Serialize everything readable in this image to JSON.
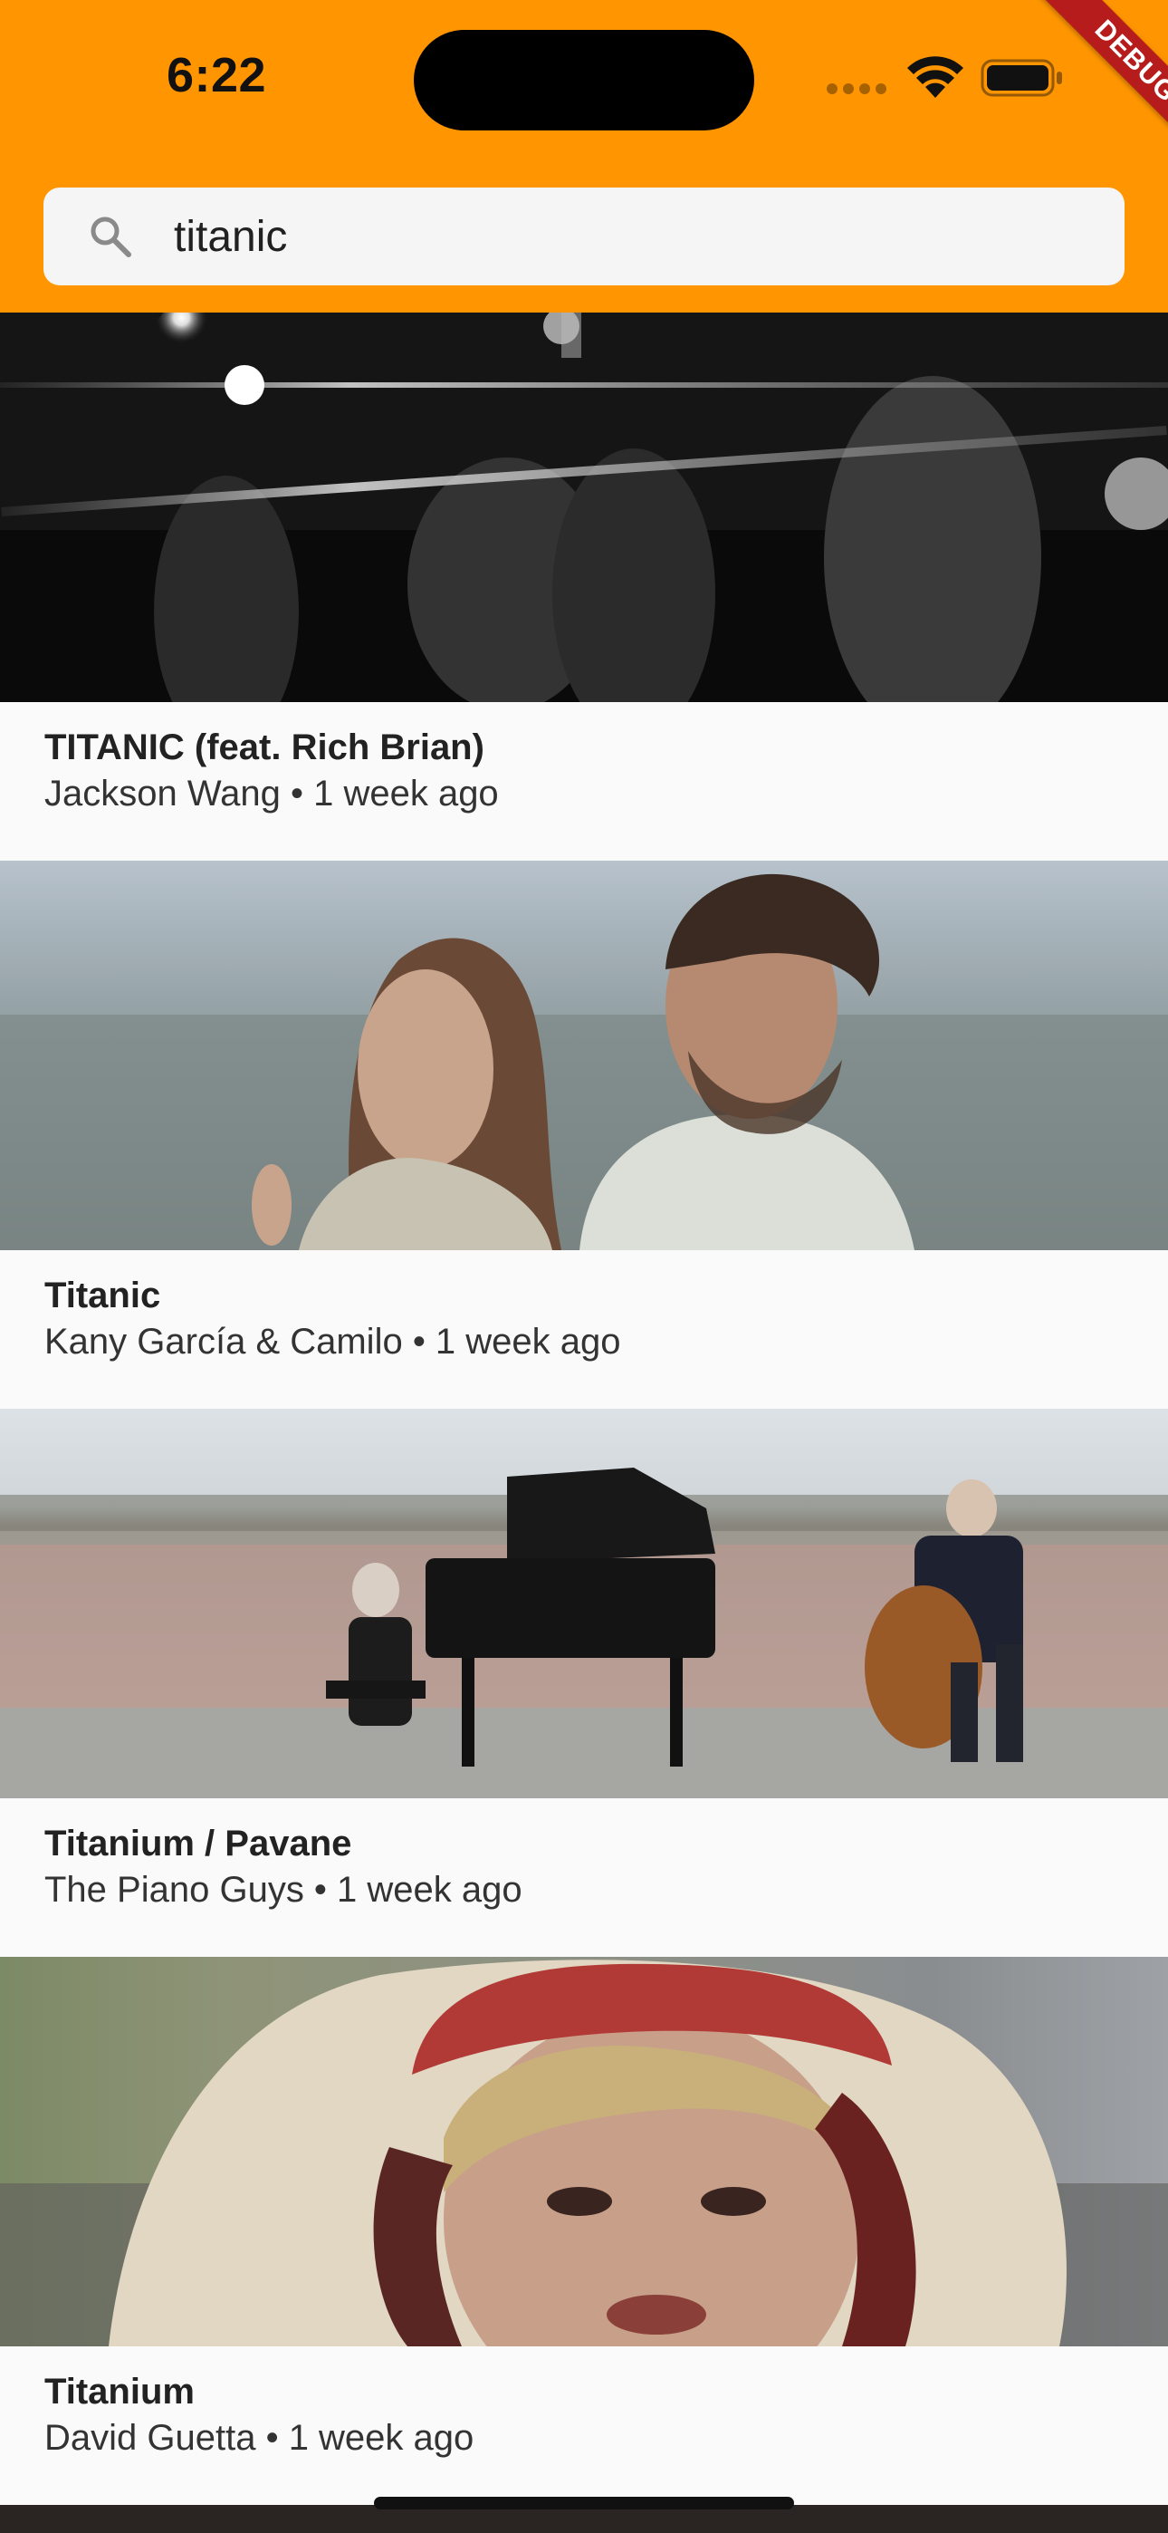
{
  "status_bar": {
    "time": "6:22"
  },
  "debug_banner": "DEBUG",
  "search": {
    "value": "titanic",
    "icon": "search-icon"
  },
  "colors": {
    "app_bar": "#ff9500",
    "search_field": "#f5f5f5",
    "background": "#fafafa",
    "debug_banner": "#b71c1c"
  },
  "videos": [
    {
      "title": "TITANIC (feat. Rich Brian)",
      "channel": "Jackson Wang",
      "age": "1 week ago",
      "meta": "Jackson Wang • 1 week ago"
    },
    {
      "title": "Titanic",
      "channel": "Kany García & Camilo",
      "age": "1 week ago",
      "meta": "Kany García & Camilo • 1 week ago"
    },
    {
      "title": "Titanium / Pavane",
      "channel": "The Piano Guys",
      "age": "1 week ago",
      "meta": "The Piano Guys • 1 week ago"
    },
    {
      "title": "Titanium",
      "channel": "David Guetta",
      "age": "1 week ago",
      "meta": "David Guetta • 1 week ago"
    }
  ]
}
